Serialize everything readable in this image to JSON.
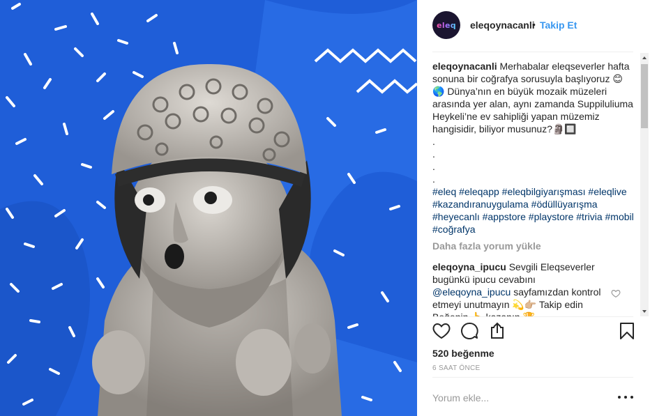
{
  "post": {
    "username": "eleqoynacanli",
    "avatar_text": "eleq",
    "separator": "•",
    "follow_label": "Takip Et"
  },
  "caption": {
    "username": "eleqoynacanli",
    "text": "Merhabalar eleqseverler hafta sonuna bir coğrafya sorusuyla başlıyoruz 😊🌎 Dünya’nın en büyük mozaik müzeleri arasında yer alan, aynı zamanda Suppiluliuma Heykeli’ne ev sahipliği yapan müzemiz hangisidir, biliyor musunuz?🗿🔲",
    "dots": [
      ".",
      ".",
      ".",
      "."
    ],
    "hashtags": [
      "#eleq",
      "#eleqapp",
      "#eleqbilgiyarışması",
      "#eleqlive",
      "#kazandıranuygulama",
      "#ödüllüyarışma",
      "#heyecanlı",
      "#appstore",
      "#playstore",
      "#trivia",
      "#mobil",
      "#coğrafya"
    ]
  },
  "load_more_label": "Daha fazla yorum yükle",
  "reply": {
    "username": "eleqoyna_ipucu",
    "text_1": "Sevgili Eleqseverler bugünkü ipucu cevabını",
    "mention": "@eleqoyna_ipucu",
    "text_2": "sayfamızdan kontrol etmeyi unutmayın 💫👉🏼 Takip edin Beğenin 👆 kazanın 🏆"
  },
  "likes_label": "520 beğenme",
  "time_label": "6 SAAT ÖNCE",
  "comment_placeholder": "Yorum ekle...",
  "icons": {
    "like": "heart-icon",
    "comment": "comment-bubble-icon",
    "share": "share-icon",
    "save": "bookmark-icon",
    "more": "more-dots-icon",
    "reply_like": "heart-icon"
  },
  "colors": {
    "link": "#3897f0",
    "hashtag": "#003569",
    "muted": "#999999",
    "media_bg": "#1f5ed8"
  }
}
